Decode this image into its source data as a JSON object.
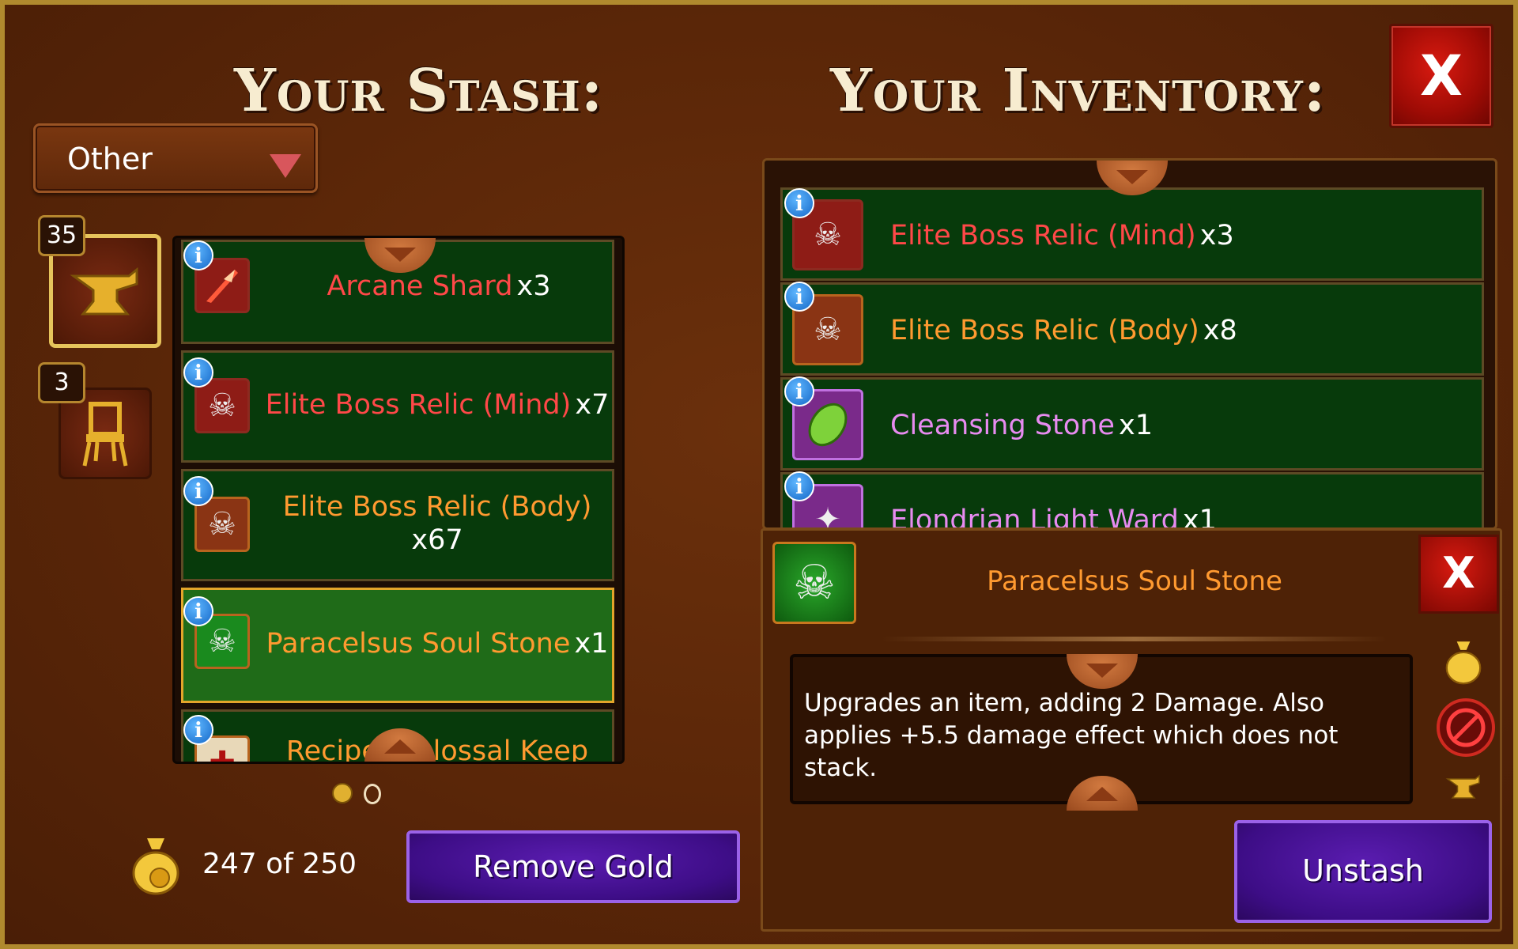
{
  "stash": {
    "title": "Your Stash:",
    "filter_value": "Other",
    "categories": [
      {
        "name": "anvil",
        "count": "35"
      },
      {
        "name": "chair",
        "count": "3"
      }
    ],
    "items": [
      {
        "name": "Arcane Shard",
        "qty": "x3",
        "color": "#ff4848"
      },
      {
        "name": "Elite Boss Relic (Mind)",
        "qty": "x7",
        "color": "#ff4848"
      },
      {
        "name": "Elite Boss Relic (Body)",
        "qty": "x67",
        "color": "#ff9a30"
      },
      {
        "name": "Paracelsus Soul Stone",
        "qty": "x1",
        "color": "#ff9a30"
      },
      {
        "name": "Recipe: Colossal Keep",
        "qty": "",
        "color": "#ff9a30"
      }
    ],
    "page_indicator": {
      "current": 1,
      "total": 2
    },
    "gold_capacity": "247 of 250",
    "remove_gold_label": "Remove Gold"
  },
  "inventory": {
    "title": "Your Inventory:",
    "items": [
      {
        "name": "Elite Boss Relic (Mind)",
        "qty": "x3",
        "color": "#ff4848"
      },
      {
        "name": "Elite Boss Relic (Body)",
        "qty": "x8",
        "color": "#ff9a30"
      },
      {
        "name": "Cleansing Stone",
        "qty": "x1",
        "color": "#e78bf0"
      },
      {
        "name": "Elondrian Light Ward",
        "qty": "x1",
        "color": "#e78bf0"
      }
    ]
  },
  "close_label": "X",
  "detail": {
    "item_name": "Paracelsus Soul Stone",
    "name_color": "#ff9a30",
    "description": "Upgrades an item, adding 2 Damage. Also applies +5.5 damage effect which does not stack.",
    "close_label": "X",
    "unstash_label": "Unstash",
    "side_icons": [
      "gold-bag-icon",
      "no-sell-icon",
      "anvil-icon"
    ]
  },
  "icons": {
    "info": "i",
    "arcane_shard": "shard-icon",
    "relic_mind": "skull-icon",
    "relic_body": "skull-icon",
    "soul_stone": "skull-icon",
    "cleansing_stone": "gem-icon",
    "light_ward": "ward-icon",
    "recipe": "recipe-icon"
  }
}
